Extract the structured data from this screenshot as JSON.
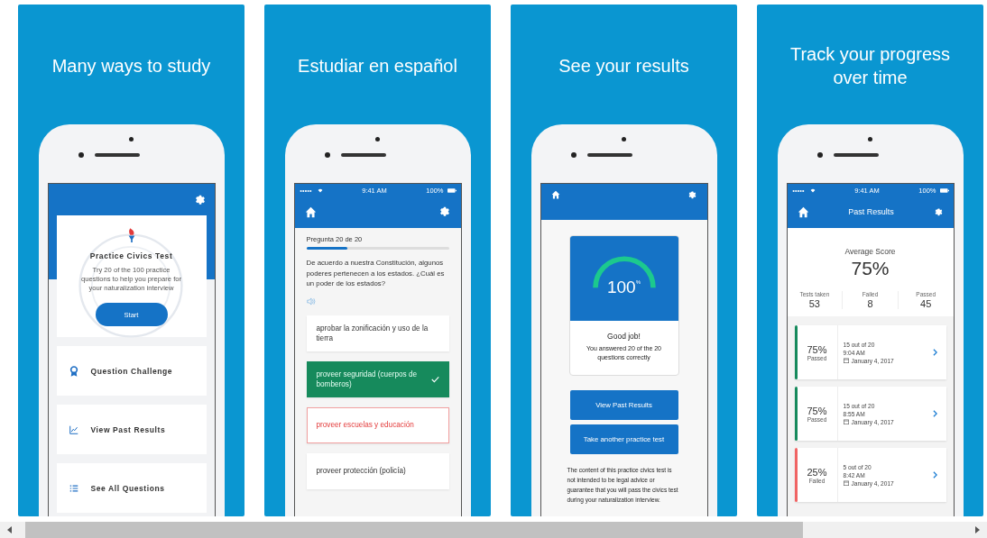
{
  "panels": [
    {
      "heading": "Many ways to study",
      "screen": {
        "kind": "home",
        "card": {
          "title": "Practice Civics Test",
          "description": "Try 20 of the 100 practice questions to help you prepare for your naturalization interview",
          "button": "Start"
        },
        "menu": [
          {
            "label": "Question Challenge",
            "kind": "award"
          },
          {
            "label": "View Past Results",
            "kind": "chart"
          },
          {
            "label": "See All Questions",
            "kind": "list"
          }
        ]
      }
    },
    {
      "heading": "Estudiar en español",
      "screen": {
        "kind": "question",
        "status_bar": {
          "time": "9:41 AM",
          "battery": "100%"
        },
        "progress": {
          "label": "Pregunta 20 de 20",
          "level": 0.29
        },
        "question": "De acuerdo a nuestra Constitución, algunos poderes pertenecen a los estados. ¿Cuál es un poder de los estados?",
        "answers": [
          {
            "text": "aprobar la zonificación y uso de la tierra",
            "kind": "plain"
          },
          {
            "text": "proveer seguridad (cuerpos de bomberos)",
            "kind": "correct"
          },
          {
            "text": "proveer escuelas y educación",
            "kind": "wrong"
          },
          {
            "text": "proveer protección (policía)",
            "kind": "plain"
          }
        ]
      }
    },
    {
      "heading": "See your results",
      "screen": {
        "kind": "result",
        "score": {
          "value": "100$^{%}$",
          "title": "Good job!",
          "message": "You answered 20 of the 20 questions correctly"
        },
        "buttons": [
          "View Past Results",
          "Take another practice test"
        ],
        "disclaimer": "The content of this practice civics test is not intended to be legal advice or guarantee that you will pass the civics test during your naturalization interview."
      }
    },
    {
      "heading": "Track your progress over time",
      "screen": {
        "kind": "history",
        "status_bar": {
          "time": "9:41 AM",
          "battery": "100%"
        },
        "title": "Past Results",
        "average": {
          "label": "Average Score",
          "value": "75%"
        },
        "stats": [
          {
            "label": "Tests taken",
            "value": "53"
          },
          {
            "label": "Failed",
            "value": "8"
          },
          {
            "label": "Passed",
            "value": "45"
          }
        ],
        "results": [
          {
            "percent": "75%",
            "status": "Passed",
            "color": "#168a5c",
            "score": "15 out of 20",
            "time": "9:04 AM",
            "date": "January 4, 2017"
          },
          {
            "percent": "75%",
            "status": "Passed",
            "color": "#168a5c",
            "score": "15 out of 20",
            "time": "8:55 AM",
            "date": "January 4, 2017"
          },
          {
            "percent": "25%",
            "status": "Failed",
            "color": "#f06464",
            "score": "5 out of 20",
            "time": "8:42 AM",
            "date": "January 4, 2017"
          }
        ]
      }
    }
  ]
}
